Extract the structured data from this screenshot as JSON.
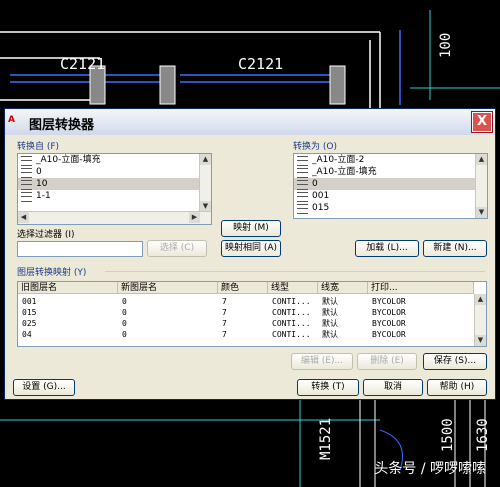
{
  "cad": {
    "dim_left": "C2121",
    "dim_right": "C2121",
    "dim_top_right": "100",
    "dim_bottom_1": "M1521",
    "dim_bottom_2": "1500",
    "dim_bottom_3": "1630"
  },
  "dialog": {
    "title": "图层转换器",
    "logo": "A",
    "close_label": "X",
    "source": {
      "label": "转换自 (F)",
      "items": [
        "_A10-立面-填充",
        "0",
        "10",
        "1-1"
      ],
      "selected_index": 2,
      "filter_label": "选择过滤器 (I)",
      "filter_value": "",
      "select_button": "选择 (C)"
    },
    "middle": {
      "map_button": "映射 (M)",
      "map_same_button": "映射相同 (A)"
    },
    "target": {
      "label": "转换为 (O)",
      "items": [
        "_A10-立面-2",
        "_A10-立面-填充",
        "0",
        "001",
        "015"
      ],
      "selected_index": 2,
      "load_button": "加载 (L)...",
      "new_button": "新建 (N)..."
    },
    "mapping": {
      "label": "图层转换映射 (Y)",
      "columns": [
        "旧图层名",
        "新图层名",
        "颜色",
        "线型",
        "线宽",
        "打印..."
      ],
      "rows": [
        [
          "001",
          "0",
          "7",
          "CONTI...",
          "默认",
          "BYCOLOR"
        ],
        [
          "015",
          "0",
          "7",
          "CONTI...",
          "默认",
          "BYCOLOR"
        ],
        [
          "025",
          "0",
          "7",
          "CONTI...",
          "默认",
          "BYCOLOR"
        ],
        [
          "04",
          "0",
          "7",
          "CONTI...",
          "默认",
          "BYCOLOR"
        ]
      ],
      "edit_button": "编辑 (E)...",
      "delete_button": "删除 (E)",
      "save_button": "保存 (S)..."
    },
    "footer": {
      "settings_button": "设置 (G)...",
      "convert_button": "转换 (T)",
      "cancel_button": "取消",
      "help_button": "帮助 (H)"
    }
  },
  "watermark": "头条号 / 啰啰嗦嗦"
}
